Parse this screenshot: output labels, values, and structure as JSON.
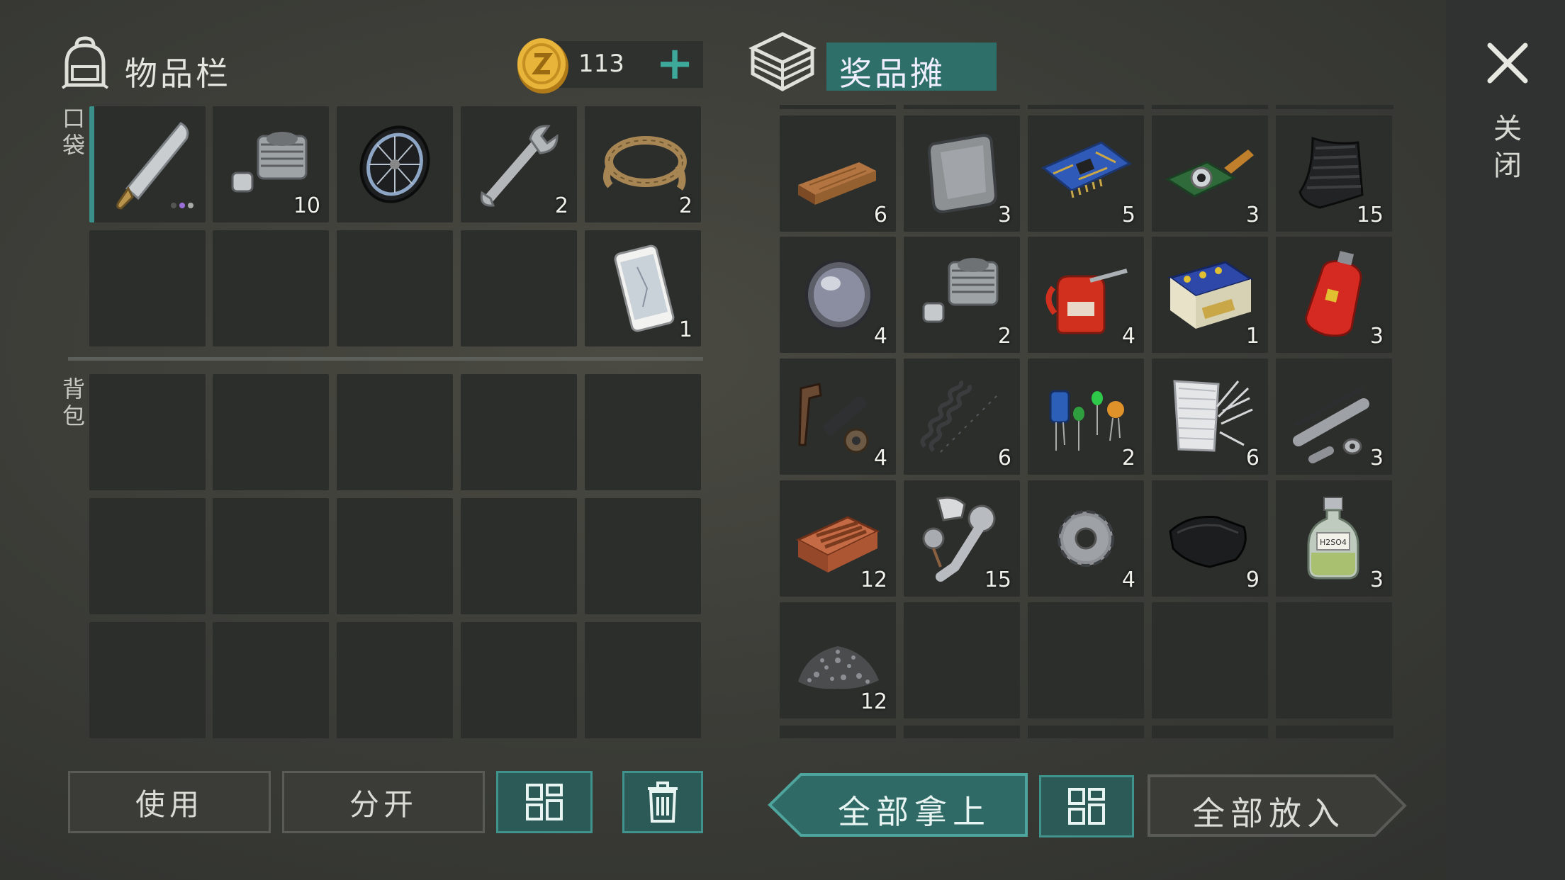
{
  "inventory": {
    "title": "物品栏",
    "coins": "113",
    "pocket_label": "口袋",
    "backpack_label": "背包",
    "slots": [
      {
        "icon": "machete-icon",
        "count": ""
      },
      {
        "icon": "engine-cylinder-icon",
        "count": "10"
      },
      {
        "icon": "wheel-icon",
        "count": ""
      },
      {
        "icon": "wrench-icon",
        "count": "2"
      },
      {
        "icon": "rope-icon",
        "count": "2"
      },
      {
        "icon": "",
        "count": ""
      },
      {
        "icon": "",
        "count": ""
      },
      {
        "icon": "",
        "count": ""
      },
      {
        "icon": "",
        "count": ""
      },
      {
        "icon": "smartphone-icon",
        "count": "1"
      }
    ]
  },
  "loot": {
    "title": "奖品摊",
    "slots": [
      {
        "icon": "wooden-plank-icon",
        "count": "6"
      },
      {
        "icon": "metal-plate-icon",
        "count": "3"
      },
      {
        "icon": "circuit-board-icon",
        "count": "5"
      },
      {
        "icon": "camera-module-icon",
        "count": "3"
      },
      {
        "icon": "rubber-mat-icon",
        "count": "15"
      },
      {
        "icon": "lens-icon",
        "count": "4"
      },
      {
        "icon": "engine-cylinder-icon",
        "count": "2"
      },
      {
        "icon": "oil-can-icon",
        "count": "4"
      },
      {
        "icon": "car-battery-icon",
        "count": "1"
      },
      {
        "icon": "gas-cylinder-icon",
        "count": "3"
      },
      {
        "icon": "gun-parts-icon",
        "count": "4"
      },
      {
        "icon": "spring-icon",
        "count": "6"
      },
      {
        "icon": "electronic-components-icon",
        "count": "2"
      },
      {
        "icon": "fiberglass-icon",
        "count": "6"
      },
      {
        "icon": "pipe-parts-icon",
        "count": "3"
      },
      {
        "icon": "brick-icon",
        "count": "12"
      },
      {
        "icon": "engine-parts-icon",
        "count": "15"
      },
      {
        "icon": "gear-icon",
        "count": "4"
      },
      {
        "icon": "leather-icon",
        "count": "9"
      },
      {
        "icon": "acid-bottle-icon",
        "count": "3"
      },
      {
        "icon": "gravel-icon",
        "count": "12"
      },
      {
        "icon": "",
        "count": ""
      },
      {
        "icon": "",
        "count": ""
      },
      {
        "icon": "",
        "count": ""
      },
      {
        "icon": "",
        "count": ""
      }
    ]
  },
  "bottle_label": "H2SO4",
  "buttons": {
    "use": "使用",
    "split": "分开",
    "take_all": "全部拿上",
    "put_all": "全部放入"
  },
  "close_label": "关闭",
  "colors": {
    "accent_teal": "#3a8f89",
    "slot_bg": "#2c2e2c",
    "coin_gold": "#e8b53a"
  }
}
